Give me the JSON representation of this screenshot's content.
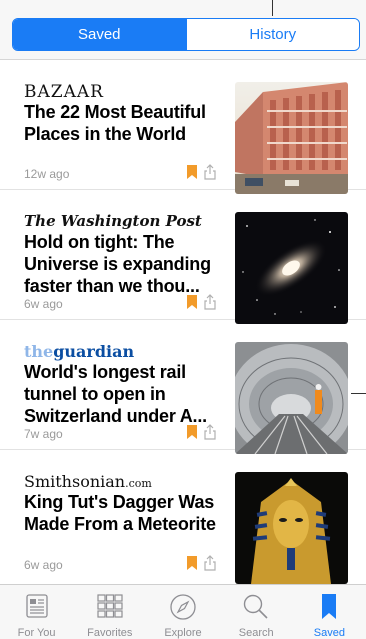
{
  "segmented": {
    "saved_label": "Saved",
    "history_label": "History",
    "selected": "Saved"
  },
  "articles": [
    {
      "source": "BAZAAR",
      "headline": "The 22 Most Beautiful Places in the World",
      "age": "12w ago",
      "bookmarked": true
    },
    {
      "source": "The Washington Post",
      "headline": "Hold on tight: The Universe is expanding faster than we thou...",
      "age": "6w ago",
      "bookmarked": true
    },
    {
      "source_prefix": "the",
      "source": "guardian",
      "headline": "World's longest rail tunnel to open in Switzerland under A...",
      "age": "7w ago",
      "bookmarked": true
    },
    {
      "source": "Smithsonian",
      "source_suffix": ".com",
      "headline": "King Tut's Dagger Was Made From a Meteorite",
      "age": "6w ago",
      "bookmarked": true
    }
  ],
  "tabbar": {
    "tabs": [
      {
        "label": "For You",
        "icon": "newspaper-icon"
      },
      {
        "label": "Favorites",
        "icon": "grid-icon"
      },
      {
        "label": "Explore",
        "icon": "compass-icon"
      },
      {
        "label": "Search",
        "icon": "search-icon"
      },
      {
        "label": "Saved",
        "icon": "bookmark-icon"
      }
    ],
    "active": "Saved"
  },
  "colors": {
    "accent": "#1a7cf5",
    "bookmark": "#f29b2a",
    "muted": "#9a9a9a"
  }
}
